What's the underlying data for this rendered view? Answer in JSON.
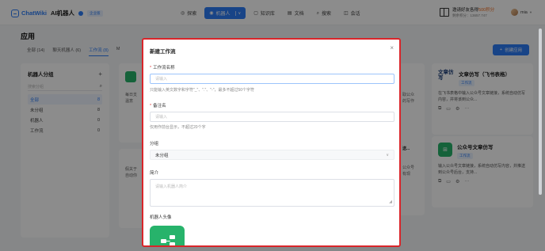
{
  "header": {
    "brand": "ChatWiki",
    "product": "AI机器人",
    "badge": "企业版",
    "nav": [
      {
        "icon": "◎",
        "label": "探索",
        "active": false
      },
      {
        "icon": "◉",
        "label": "机器人",
        "active": true,
        "caret": "∨"
      },
      {
        "icon": "▢",
        "label": "知识库",
        "active": false
      },
      {
        "icon": "▤",
        "label": "文档",
        "active": false
      },
      {
        "icon": "⌕",
        "label": "搜索",
        "active": false
      },
      {
        "icon": "◫",
        "label": "会话",
        "active": false
      }
    ],
    "invite_line1_pre": "邀请好友各得",
    "invite_line1_highlight": "500积分",
    "invite_line2": "剩余积分：13657.747",
    "user_name": "mia"
  },
  "page": {
    "title": "应用",
    "tabs": [
      {
        "label": "全部 (14)",
        "active": false
      },
      {
        "label": "聊天机器人 (6)",
        "active": false
      },
      {
        "label": "工作流 (8)",
        "active": true
      },
      {
        "label": "M",
        "active": false
      }
    ],
    "create_button": "创建应用",
    "create_icon": "+"
  },
  "groups": {
    "title": "机器人分组",
    "add_icon": "+",
    "search_placeholder": "搜索分组",
    "items": [
      {
        "label": "全部",
        "count": "8",
        "active": true
      },
      {
        "label": "未分组",
        "count": "8",
        "active": false
      },
      {
        "label": "机器人",
        "count": "0",
        "active": false
      },
      {
        "label": "工作流",
        "count": "0",
        "active": false
      }
    ]
  },
  "background_cards": {
    "left_top_text1": "每日支",
    "left_top_text2": "温意",
    "left_bottom_text1": "假关于",
    "left_bottom_text2": "自动你",
    "mid_top_text1": "取公众",
    "mid_top_text2": "的写作",
    "mid_bottom_title": "送...",
    "mid_bottom_text1": "公众号",
    "mid_bottom_text2": "有现",
    "right_top": {
      "icon_text": "文章仿写",
      "title": "文章仿写（飞书表格）",
      "tag": "工作流",
      "desc": "在飞书表格中输入公众号文章链接，系统自动仿写内容，并将该到公众..."
    },
    "right_bottom": {
      "icon_glyph": "⊞",
      "title": "公众号文章仿写",
      "tag": "工作流",
      "desc": "输入公众号文章链接，系统自动仿写内容，并推送到公众号后台，支持..."
    }
  },
  "modal": {
    "title": "新建工作流",
    "close": "×",
    "name_label": "工作流名称",
    "name_placeholder": "请输入",
    "name_hint": "只能输入英文数字和字符\"_\"、\".\"、\"-\"，最多不超过50个字符",
    "note_label": "备注名",
    "note_placeholder": "请输入",
    "note_hint": "仅用作前台显示，不超过20个字",
    "group_label": "分组",
    "group_value": "未分组",
    "intro_label": "简介",
    "intro_placeholder": "请输入机器人简介",
    "avatar_label": "机器人头像",
    "required_mark": "*"
  }
}
